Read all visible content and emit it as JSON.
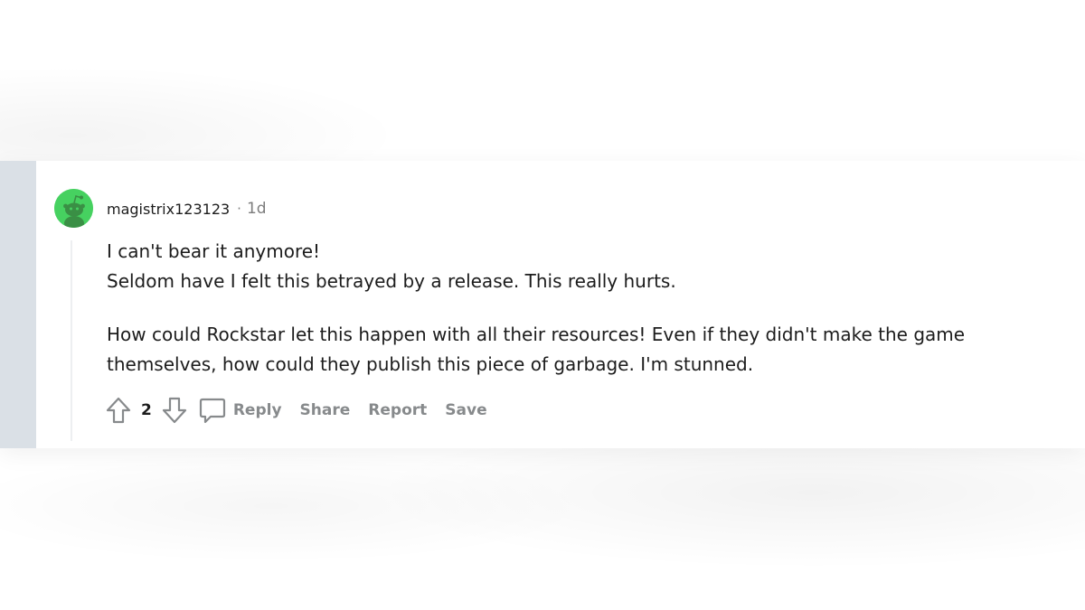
{
  "comment": {
    "author": "magistrix123123",
    "separator": "·",
    "age": "1d",
    "avatar_icon": "snoo-avatar-icon",
    "avatar_color": "#46d160",
    "paragraphs": [
      "I can't bear it anymore!",
      "Seldom have I felt this betrayed by a release. This really hurts.",
      "How could Rockstar let this happen with all their resources! Even if they didn't make the game themselves, how could they publish this piece of garbage. I'm stunned."
    ],
    "score": "2"
  },
  "actions": {
    "upvote_icon": "arrow-up-icon",
    "downvote_icon": "arrow-down-icon",
    "reply_icon": "speech-bubble-icon",
    "reply_label": "Reply",
    "share_label": "Share",
    "report_label": "Report",
    "save_label": "Save"
  },
  "colors": {
    "gutter": "#dae0e6",
    "action_text": "#878a8c",
    "body_text": "#1c1c1c"
  }
}
